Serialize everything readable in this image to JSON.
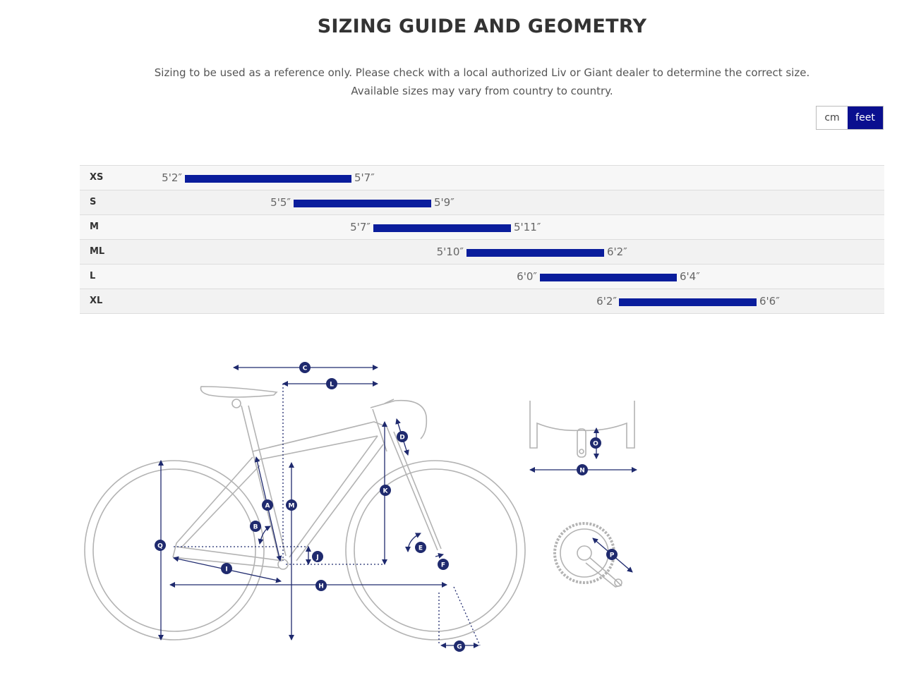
{
  "page": {
    "title": "SIZING GUIDE AND GEOMETRY",
    "subtitle_line1": "Sizing to be used as a reference only. Please check with a local authorized Liv or Giant dealer to determine the correct size.",
    "subtitle_line2": "Available sizes may vary from country to country."
  },
  "units": {
    "cm": "cm",
    "feet": "feet",
    "selected": "feet"
  },
  "colors": {
    "accent": "#0a0f8f",
    "bar": "#0a1d9c",
    "diagram_line": "#b3b3b3",
    "diagram_marker": "#1f2a6e"
  },
  "sizes": [
    {
      "label": "XS",
      "min": "5'2″",
      "max": "5'7″"
    },
    {
      "label": "S",
      "min": "5'5″",
      "max": "5'9″"
    },
    {
      "label": "M",
      "min": "5'7″",
      "max": "5'11″"
    },
    {
      "label": "ML",
      "min": "5'10″",
      "max": "6'2″"
    },
    {
      "label": "L",
      "min": "6'0″",
      "max": "6'4″"
    },
    {
      "label": "XL",
      "min": "6'2″",
      "max": "6'6″"
    }
  ],
  "geometry_labels": [
    "A",
    "B",
    "C",
    "D",
    "E",
    "F",
    "G",
    "H",
    "I",
    "J",
    "K",
    "L",
    "M",
    "N",
    "O",
    "P",
    "Q"
  ]
}
